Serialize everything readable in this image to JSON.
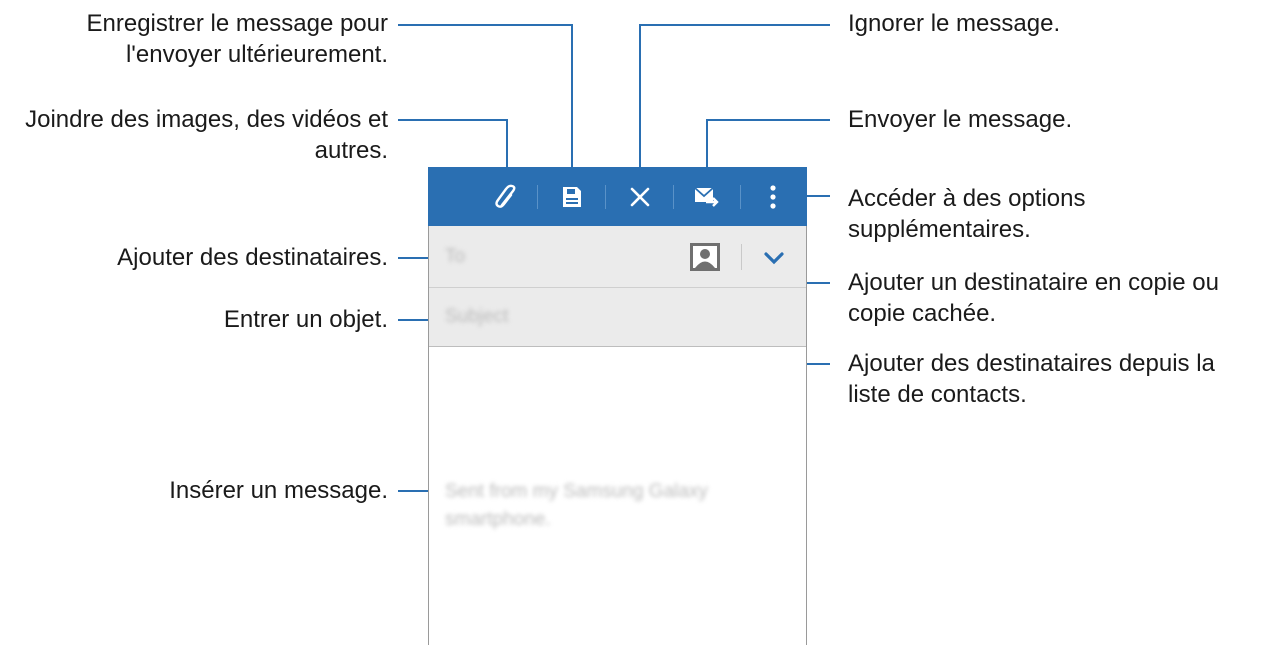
{
  "colors": {
    "toolbar": "#2a6fb2",
    "leader": "#2a6fb2",
    "field_bg": "#ebebeb"
  },
  "annotations": {
    "save": "Enregistrer le message pour\nl'envoyer ultérieurement.",
    "attach": "Joindre des images, des vidéos et\nautres.",
    "add_recipients": "Ajouter des destinataires.",
    "subject": "Entrer un objet.",
    "insert_message": "Insérer un message.",
    "discard": "Ignorer le message.",
    "send": "Envoyer le message.",
    "more_options": "Accéder à des options\nsupplémentaires.",
    "cc_bcc": "Ajouter un destinataire en copie ou\ncopie cachée.",
    "contacts": "Ajouter des destinataires depuis la\nliste de contacts."
  },
  "toolbar": {
    "icons": [
      "paperclip-icon",
      "save-icon",
      "close-icon",
      "send-mail-icon",
      "more-vertical-icon"
    ]
  },
  "compose": {
    "to_placeholder": "To",
    "subject_placeholder": "Subject",
    "body_text": "Sent from my Samsung Galaxy smartphone."
  }
}
